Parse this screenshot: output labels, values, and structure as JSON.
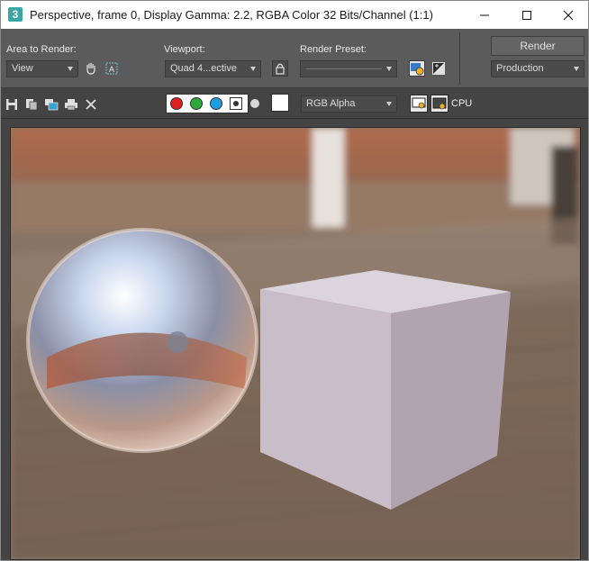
{
  "window": {
    "title": "Perspective, frame 0, Display Gamma: 2.2, RGBA Color 32 Bits/Channel (1:1)",
    "app_icon_glyph": "3"
  },
  "panel": {
    "area_label": "Area to Render:",
    "area_value": "View",
    "viewport_label": "Viewport:",
    "viewport_value": "Quad 4...ective",
    "preset_label": "Render Preset:",
    "preset_value": "",
    "render_button": "Render",
    "production_value": "Production"
  },
  "toolbar": {
    "channel_value": "RGB Alpha",
    "cpu_label": "CPU",
    "channels": {
      "red": "#e02020",
      "green": "#2ea83a",
      "blue": "#1aa0e0"
    }
  },
  "icons": [
    "app-icon",
    "minimize-icon",
    "maximize-icon",
    "close-icon",
    "pan-hand-icon",
    "auto-region-icon",
    "lock-icon",
    "environment-icon",
    "exposure-icon",
    "save-image-icon",
    "copy-image-icon",
    "clone-window-icon",
    "print-icon",
    "clear-icon"
  ]
}
